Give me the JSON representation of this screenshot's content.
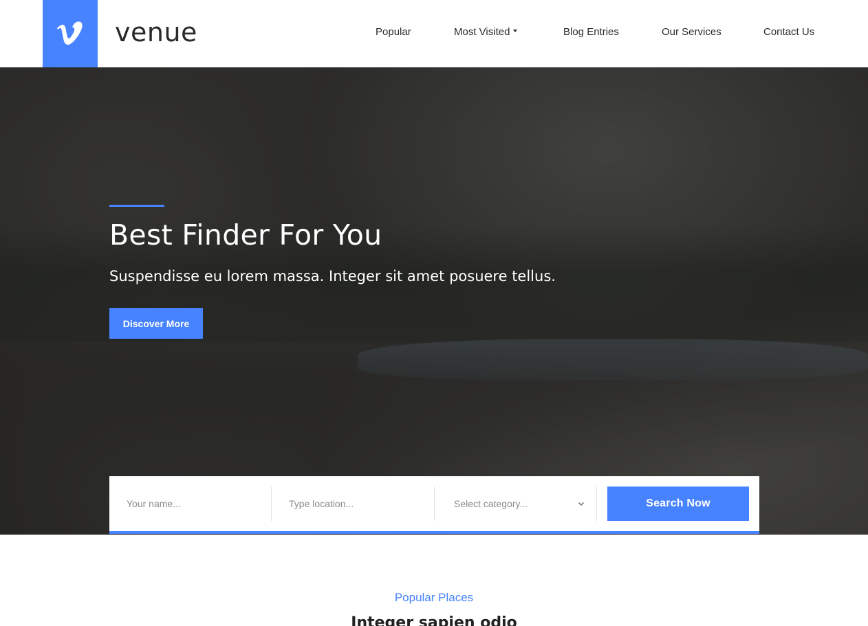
{
  "brand": {
    "name": "venue",
    "logo_icon": "vimeo-v-icon",
    "accent": "#4883ff"
  },
  "nav": {
    "items": [
      {
        "label": "Popular"
      },
      {
        "label": "Most Visited",
        "has_dropdown": true
      },
      {
        "label": "Blog Entries"
      },
      {
        "label": "Our Services"
      },
      {
        "label": "Contact Us"
      }
    ]
  },
  "hero": {
    "title": "Best Finder For You",
    "subtitle": "Suspendisse eu lorem massa. Integer sit amet posuere tellus.",
    "cta_label": "Discover More"
  },
  "search": {
    "name_placeholder": "Your name...",
    "location_placeholder": "Type location...",
    "category_selected": "Select category...",
    "button_label": "Search Now"
  },
  "section": {
    "kicker": "Popular Places",
    "title": "Integer sapien odio"
  },
  "colors": {
    "accent": "#4883ff",
    "text_dark": "#2a2a2a",
    "placeholder": "#8a8a8a"
  }
}
